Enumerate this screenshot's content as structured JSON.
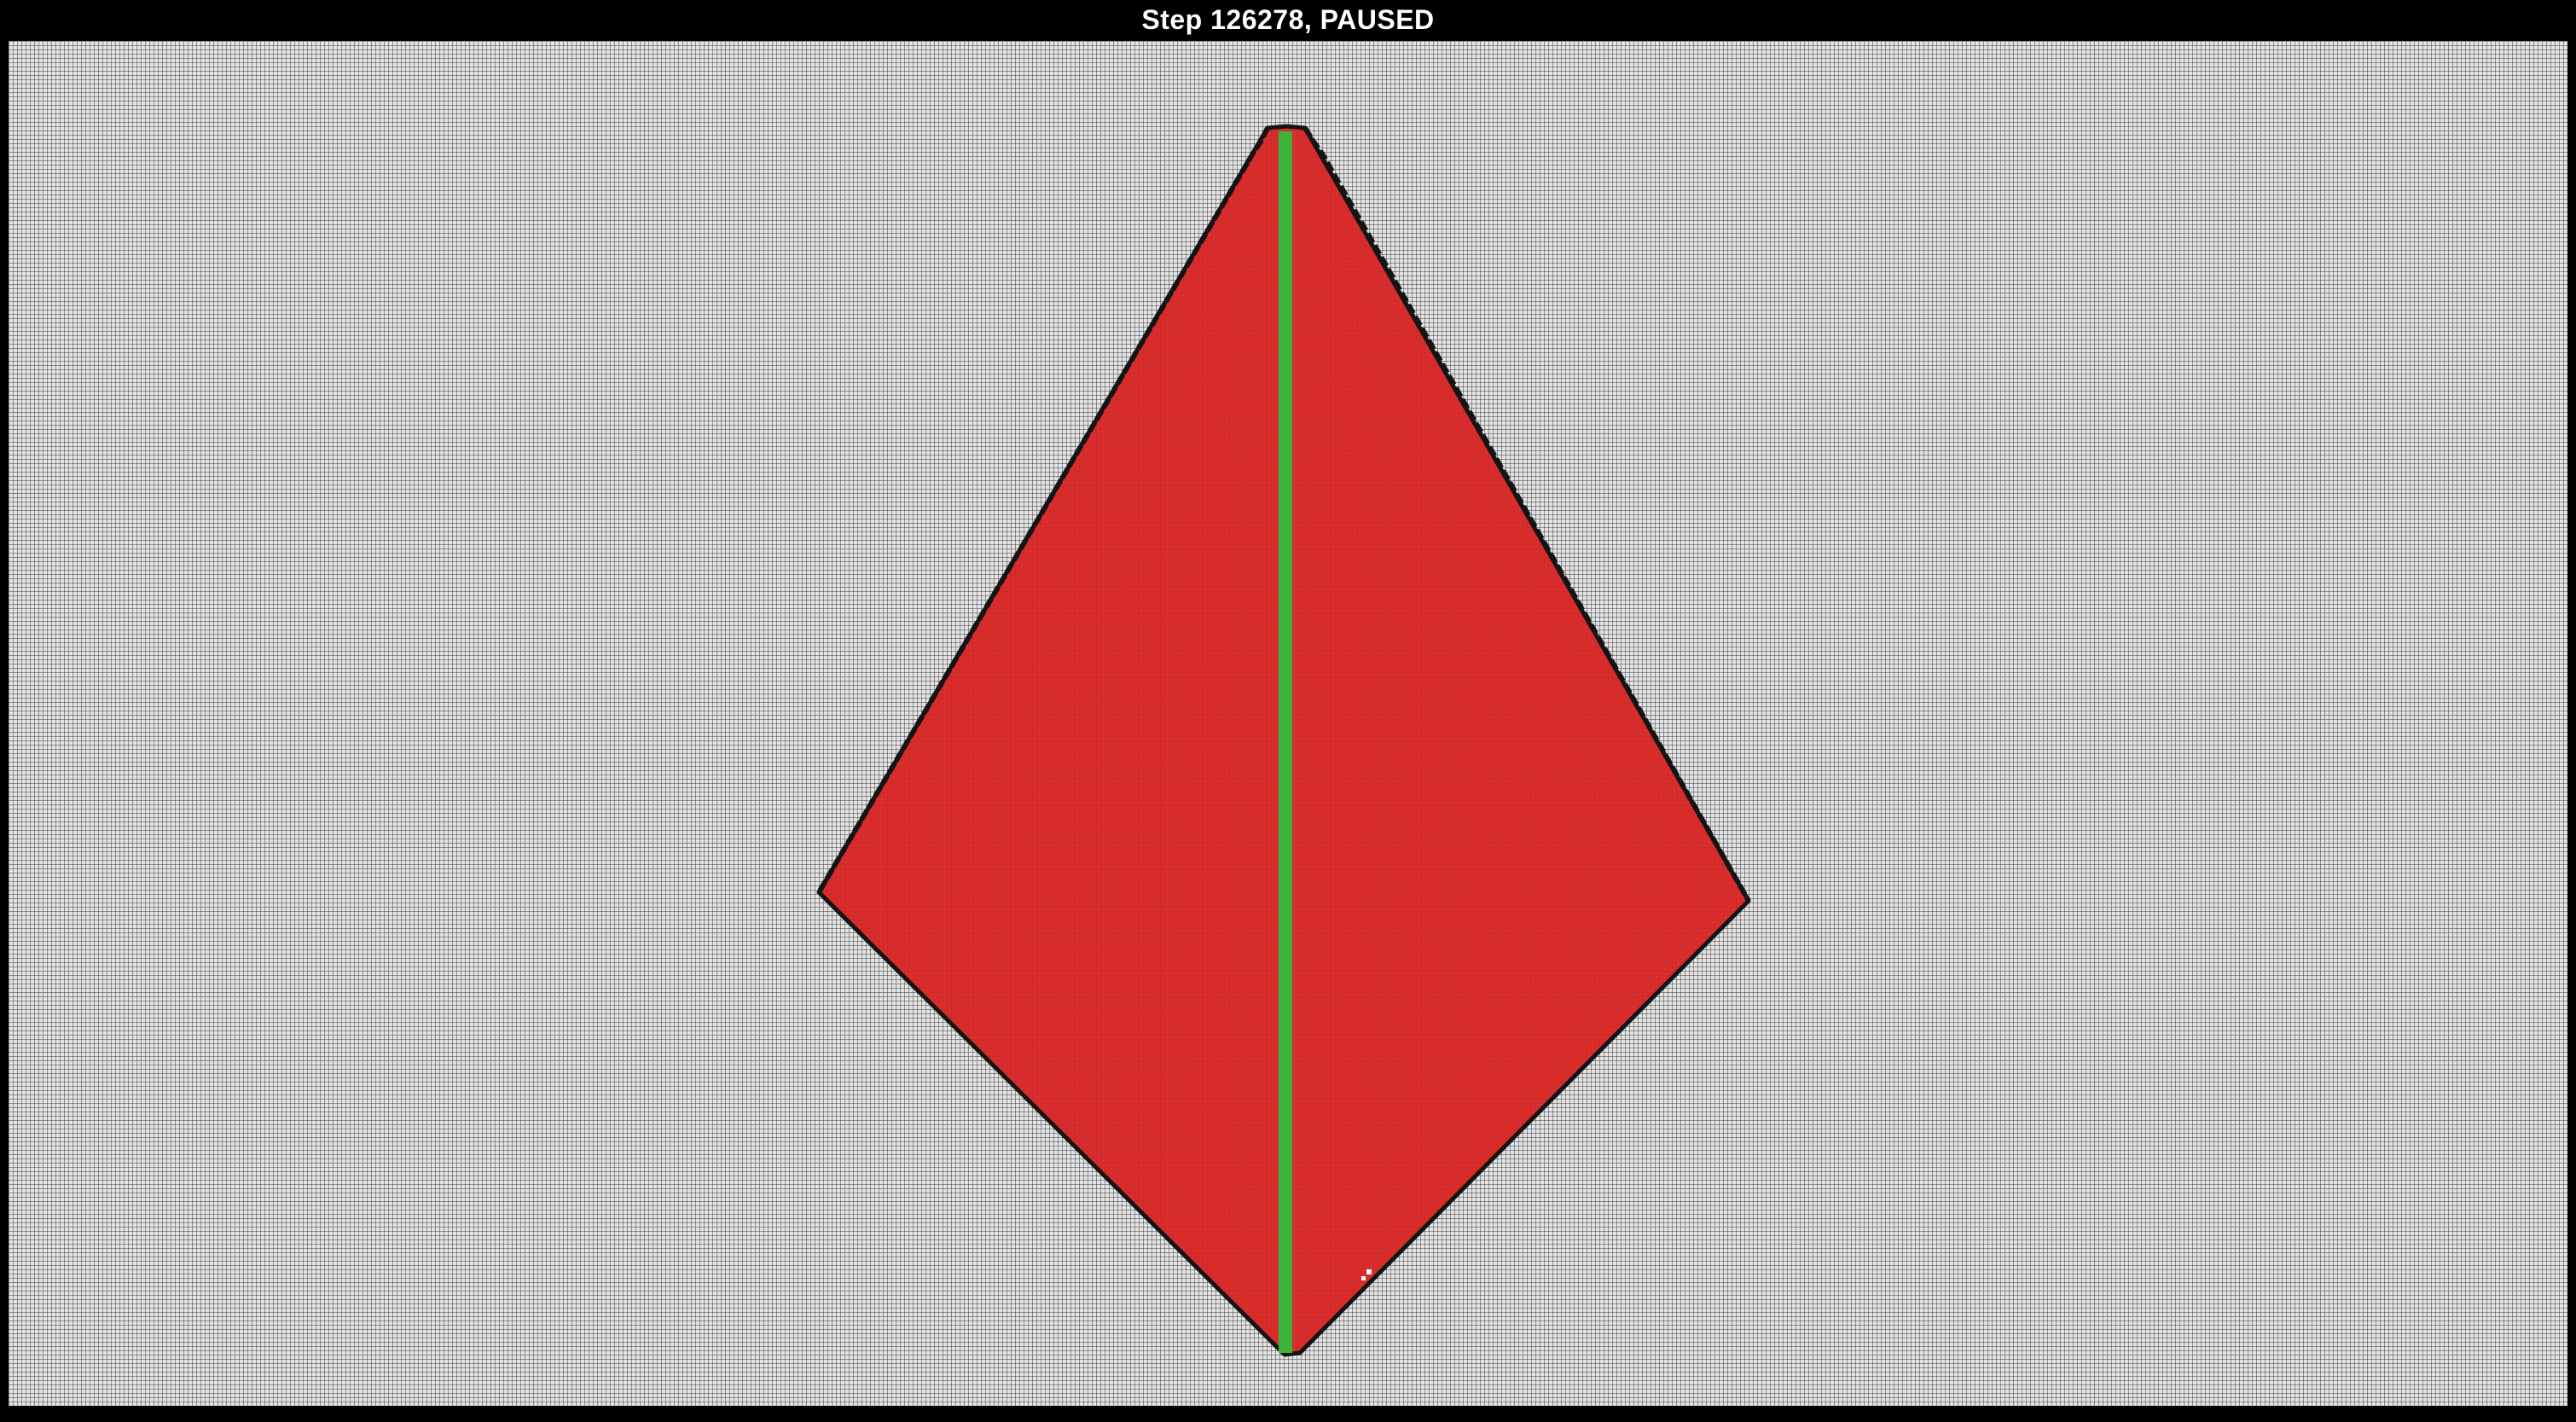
{
  "window": {
    "status": "Step 126278, PAUSED"
  },
  "simulation": {
    "step": 126278,
    "state": "PAUSED",
    "colors": {
      "background": "#000000",
      "grid_empty": "#e4e4e4",
      "grid_line": "#464646",
      "region_fill": "#dc2d2d",
      "region_border": "#141414",
      "stem": "#3cb43c",
      "status_text": "#ffffff"
    }
  }
}
